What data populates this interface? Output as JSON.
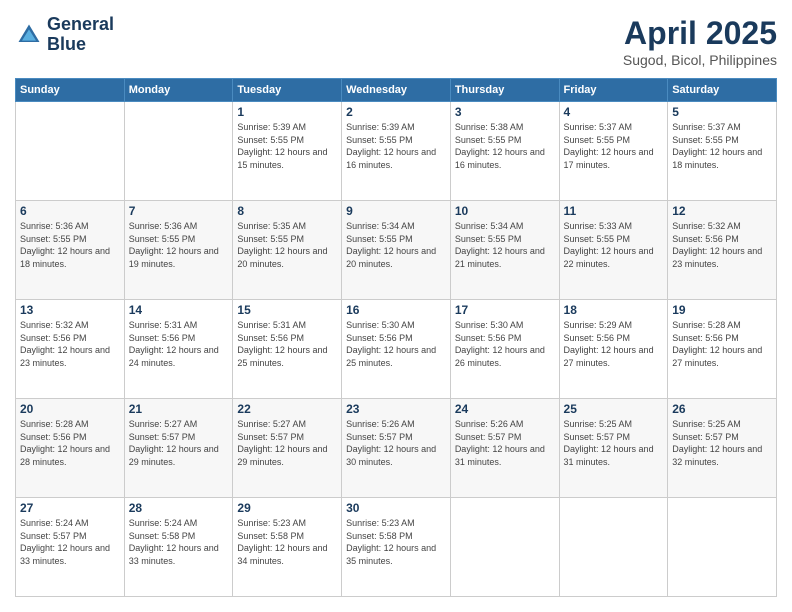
{
  "logo": {
    "line1": "General",
    "line2": "Blue"
  },
  "title": "April 2025",
  "subtitle": "Sugod, Bicol, Philippines",
  "days_header": [
    "Sunday",
    "Monday",
    "Tuesday",
    "Wednesday",
    "Thursday",
    "Friday",
    "Saturday"
  ],
  "weeks": [
    [
      {
        "day": "",
        "sunrise": "",
        "sunset": "",
        "daylight": ""
      },
      {
        "day": "",
        "sunrise": "",
        "sunset": "",
        "daylight": ""
      },
      {
        "day": "1",
        "sunrise": "Sunrise: 5:39 AM",
        "sunset": "Sunset: 5:55 PM",
        "daylight": "Daylight: 12 hours and 15 minutes."
      },
      {
        "day": "2",
        "sunrise": "Sunrise: 5:39 AM",
        "sunset": "Sunset: 5:55 PM",
        "daylight": "Daylight: 12 hours and 16 minutes."
      },
      {
        "day": "3",
        "sunrise": "Sunrise: 5:38 AM",
        "sunset": "Sunset: 5:55 PM",
        "daylight": "Daylight: 12 hours and 16 minutes."
      },
      {
        "day": "4",
        "sunrise": "Sunrise: 5:37 AM",
        "sunset": "Sunset: 5:55 PM",
        "daylight": "Daylight: 12 hours and 17 minutes."
      },
      {
        "day": "5",
        "sunrise": "Sunrise: 5:37 AM",
        "sunset": "Sunset: 5:55 PM",
        "daylight": "Daylight: 12 hours and 18 minutes."
      }
    ],
    [
      {
        "day": "6",
        "sunrise": "Sunrise: 5:36 AM",
        "sunset": "Sunset: 5:55 PM",
        "daylight": "Daylight: 12 hours and 18 minutes."
      },
      {
        "day": "7",
        "sunrise": "Sunrise: 5:36 AM",
        "sunset": "Sunset: 5:55 PM",
        "daylight": "Daylight: 12 hours and 19 minutes."
      },
      {
        "day": "8",
        "sunrise": "Sunrise: 5:35 AM",
        "sunset": "Sunset: 5:55 PM",
        "daylight": "Daylight: 12 hours and 20 minutes."
      },
      {
        "day": "9",
        "sunrise": "Sunrise: 5:34 AM",
        "sunset": "Sunset: 5:55 PM",
        "daylight": "Daylight: 12 hours and 20 minutes."
      },
      {
        "day": "10",
        "sunrise": "Sunrise: 5:34 AM",
        "sunset": "Sunset: 5:55 PM",
        "daylight": "Daylight: 12 hours and 21 minutes."
      },
      {
        "day": "11",
        "sunrise": "Sunrise: 5:33 AM",
        "sunset": "Sunset: 5:55 PM",
        "daylight": "Daylight: 12 hours and 22 minutes."
      },
      {
        "day": "12",
        "sunrise": "Sunrise: 5:32 AM",
        "sunset": "Sunset: 5:56 PM",
        "daylight": "Daylight: 12 hours and 23 minutes."
      }
    ],
    [
      {
        "day": "13",
        "sunrise": "Sunrise: 5:32 AM",
        "sunset": "Sunset: 5:56 PM",
        "daylight": "Daylight: 12 hours and 23 minutes."
      },
      {
        "day": "14",
        "sunrise": "Sunrise: 5:31 AM",
        "sunset": "Sunset: 5:56 PM",
        "daylight": "Daylight: 12 hours and 24 minutes."
      },
      {
        "day": "15",
        "sunrise": "Sunrise: 5:31 AM",
        "sunset": "Sunset: 5:56 PM",
        "daylight": "Daylight: 12 hours and 25 minutes."
      },
      {
        "day": "16",
        "sunrise": "Sunrise: 5:30 AM",
        "sunset": "Sunset: 5:56 PM",
        "daylight": "Daylight: 12 hours and 25 minutes."
      },
      {
        "day": "17",
        "sunrise": "Sunrise: 5:30 AM",
        "sunset": "Sunset: 5:56 PM",
        "daylight": "Daylight: 12 hours and 26 minutes."
      },
      {
        "day": "18",
        "sunrise": "Sunrise: 5:29 AM",
        "sunset": "Sunset: 5:56 PM",
        "daylight": "Daylight: 12 hours and 27 minutes."
      },
      {
        "day": "19",
        "sunrise": "Sunrise: 5:28 AM",
        "sunset": "Sunset: 5:56 PM",
        "daylight": "Daylight: 12 hours and 27 minutes."
      }
    ],
    [
      {
        "day": "20",
        "sunrise": "Sunrise: 5:28 AM",
        "sunset": "Sunset: 5:56 PM",
        "daylight": "Daylight: 12 hours and 28 minutes."
      },
      {
        "day": "21",
        "sunrise": "Sunrise: 5:27 AM",
        "sunset": "Sunset: 5:57 PM",
        "daylight": "Daylight: 12 hours and 29 minutes."
      },
      {
        "day": "22",
        "sunrise": "Sunrise: 5:27 AM",
        "sunset": "Sunset: 5:57 PM",
        "daylight": "Daylight: 12 hours and 29 minutes."
      },
      {
        "day": "23",
        "sunrise": "Sunrise: 5:26 AM",
        "sunset": "Sunset: 5:57 PM",
        "daylight": "Daylight: 12 hours and 30 minutes."
      },
      {
        "day": "24",
        "sunrise": "Sunrise: 5:26 AM",
        "sunset": "Sunset: 5:57 PM",
        "daylight": "Daylight: 12 hours and 31 minutes."
      },
      {
        "day": "25",
        "sunrise": "Sunrise: 5:25 AM",
        "sunset": "Sunset: 5:57 PM",
        "daylight": "Daylight: 12 hours and 31 minutes."
      },
      {
        "day": "26",
        "sunrise": "Sunrise: 5:25 AM",
        "sunset": "Sunset: 5:57 PM",
        "daylight": "Daylight: 12 hours and 32 minutes."
      }
    ],
    [
      {
        "day": "27",
        "sunrise": "Sunrise: 5:24 AM",
        "sunset": "Sunset: 5:57 PM",
        "daylight": "Daylight: 12 hours and 33 minutes."
      },
      {
        "day": "28",
        "sunrise": "Sunrise: 5:24 AM",
        "sunset": "Sunset: 5:58 PM",
        "daylight": "Daylight: 12 hours and 33 minutes."
      },
      {
        "day": "29",
        "sunrise": "Sunrise: 5:23 AM",
        "sunset": "Sunset: 5:58 PM",
        "daylight": "Daylight: 12 hours and 34 minutes."
      },
      {
        "day": "30",
        "sunrise": "Sunrise: 5:23 AM",
        "sunset": "Sunset: 5:58 PM",
        "daylight": "Daylight: 12 hours and 35 minutes."
      },
      {
        "day": "",
        "sunrise": "",
        "sunset": "",
        "daylight": ""
      },
      {
        "day": "",
        "sunrise": "",
        "sunset": "",
        "daylight": ""
      },
      {
        "day": "",
        "sunrise": "",
        "sunset": "",
        "daylight": ""
      }
    ]
  ]
}
